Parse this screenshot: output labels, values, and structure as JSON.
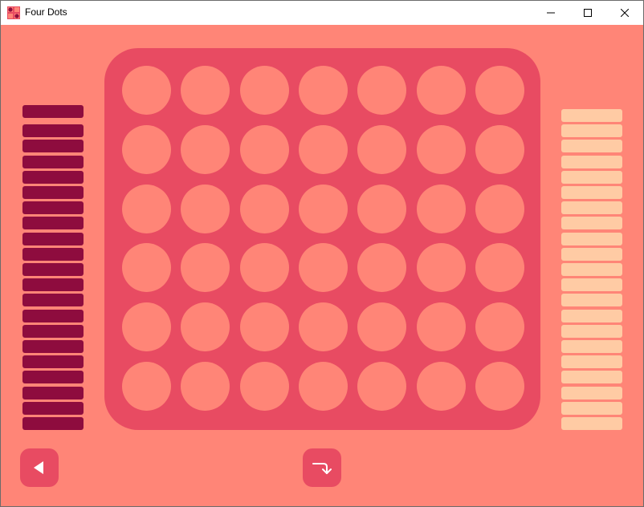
{
  "window": {
    "title": "Four Dots",
    "icon": "four-dots-app-icon",
    "controls": [
      "minimize-icon",
      "maximize-icon",
      "close-icon"
    ]
  },
  "colors": {
    "background": "#ff8577",
    "board": "#e84b62",
    "empty_slot": "#ff8577",
    "player_one_token": "#8e0c3e",
    "player_two_token": "#ffcba4",
    "button": "#e84b62",
    "button_icon": "#ffffff"
  },
  "board": {
    "columns": 7,
    "rows": 6,
    "cells": [
      [
        "empty",
        "empty",
        "empty",
        "empty",
        "empty",
        "empty",
        "empty"
      ],
      [
        "empty",
        "empty",
        "empty",
        "empty",
        "empty",
        "empty",
        "empty"
      ],
      [
        "empty",
        "empty",
        "empty",
        "empty",
        "empty",
        "empty",
        "empty"
      ],
      [
        "empty",
        "empty",
        "empty",
        "empty",
        "empty",
        "empty",
        "empty"
      ],
      [
        "empty",
        "empty",
        "empty",
        "empty",
        "empty",
        "empty",
        "empty"
      ],
      [
        "empty",
        "empty",
        "empty",
        "empty",
        "empty",
        "empty",
        "empty"
      ]
    ]
  },
  "player_one": {
    "side": "left",
    "tokens_remaining": 21,
    "active": true
  },
  "player_two": {
    "side": "right",
    "tokens_remaining": 21,
    "active": false
  },
  "controls": {
    "back_icon": "triangle-left-icon",
    "drop_icon": "turn-down-arrow-icon"
  }
}
